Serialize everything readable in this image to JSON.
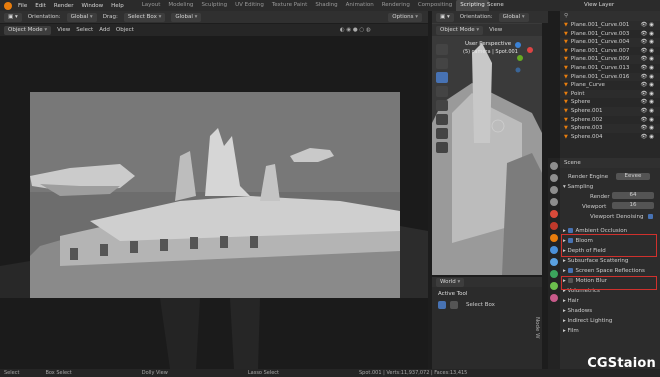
{
  "menubar": {
    "items": [
      "File",
      "Edit",
      "Render",
      "Window",
      "Help"
    ],
    "workspaces": [
      "Layout",
      "Modeling",
      "Sculpting",
      "UV Editing",
      "Texture Paint",
      "Shading",
      "Animation",
      "Rendering",
      "Compositing",
      "Scripting"
    ],
    "active_workspace": "Scripting",
    "scene": "Scene",
    "view_layer": "View Layer"
  },
  "toolbar_main": {
    "orientation_label": "Orientation:",
    "orientation_value": "Global",
    "drag_label": "Drag:",
    "drag_value": "Select Box",
    "transform_value": "Global",
    "options": "Options"
  },
  "toolbar_side": {
    "orientation_label": "Orientation:",
    "orientation_value": "Global"
  },
  "viewport_header": {
    "mode": "Object Mode",
    "menus": [
      "View",
      "Select",
      "Add",
      "Object"
    ]
  },
  "side_viewport": {
    "mode": "Object Mode",
    "menus": [
      "View"
    ],
    "perspective": "User Perspective",
    "context": "(5) camera | Spot.001"
  },
  "outliner": {
    "items": [
      {
        "name": "Plane.001_Curve.001"
      },
      {
        "name": "Plane.001_Curve.003"
      },
      {
        "name": "Plane.001_Curve.004"
      },
      {
        "name": "Plane.001_Curve.007"
      },
      {
        "name": "Plane.001_Curve.009"
      },
      {
        "name": "Plane.001_Curve.013"
      },
      {
        "name": "Plane.001_Curve.016"
      },
      {
        "name": "Plane_Curve"
      },
      {
        "name": "Point"
      },
      {
        "name": "Sphere"
      },
      {
        "name": "Sphere.001"
      },
      {
        "name": "Sphere.002"
      },
      {
        "name": "Sphere.003"
      },
      {
        "name": "Sphere.004"
      }
    ]
  },
  "properties": {
    "scene": "Scene",
    "render_engine_label": "Render Engine",
    "render_engine": "Eevee",
    "sampling": "Sampling",
    "render_label": "Render",
    "render_value": "64",
    "viewport_label": "Viewport",
    "viewport_value": "16",
    "viewport_denoising": "Viewport Denoising",
    "panels": [
      {
        "label": "Ambient Occlusion",
        "checked": true,
        "highlight": true
      },
      {
        "label": "Bloom",
        "checked": true,
        "highlight": true
      },
      {
        "label": "Depth of Field",
        "checked": false,
        "highlight": false
      },
      {
        "label": "Subsurface Scattering",
        "checked": false,
        "highlight": false
      },
      {
        "label": "Screen Space Reflections",
        "checked": true,
        "highlight": true
      },
      {
        "label": "Motion Blur",
        "checked": false,
        "highlight": false
      },
      {
        "label": "Volumetrics",
        "checked": false,
        "highlight": false
      },
      {
        "label": "Hair",
        "checked": false,
        "highlight": false
      },
      {
        "label": "Shadows",
        "checked": false,
        "highlight": false
      },
      {
        "label": "Indirect Lighting",
        "checked": false,
        "highlight": false
      },
      {
        "label": "Film",
        "checked": false,
        "highlight": false
      }
    ]
  },
  "tool_panel": {
    "world": "World",
    "active_tool": "Active Tool",
    "select_box": "Select Box",
    "side_label": "Node W"
  },
  "statusbar": {
    "items": [
      "Select",
      "Box Select",
      "Dolly View",
      "Lasso Select"
    ],
    "stats": "Spot.001 | Verts:11,937,072 | Faces:13,415"
  },
  "watermark": "CGStaion",
  "colors": {
    "accent": "#e87d0d",
    "blue": "#4772b3",
    "highlight_red": "#d0312d"
  }
}
